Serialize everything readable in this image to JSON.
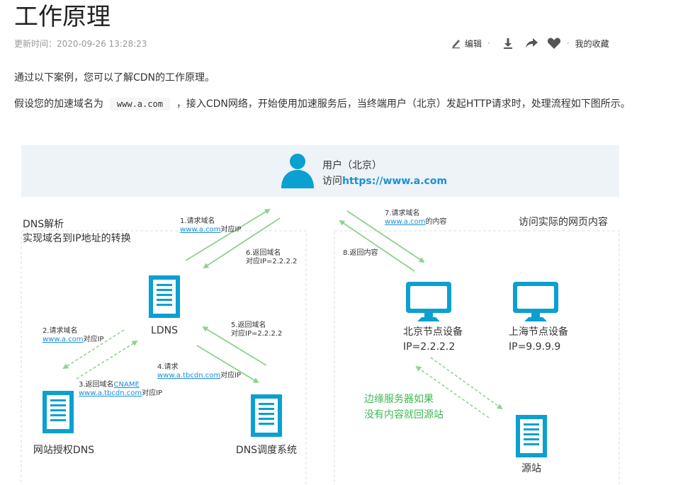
{
  "article": {
    "title": "工作原理",
    "updated": "更新时间：2020-09-26 13:28:23",
    "intro": "通过以下案例，您可以了解CDN的工作原理。",
    "para2_prefix": "假设您的加速域名为",
    "para2_code": "www.a.com",
    "para2_suffix": "，接入CDN网络，开始使用加速服务后，当终端用户（北京）发起HTTP请求时，处理流程如下图所示。"
  },
  "toolbar": {
    "edit": "编辑",
    "favorites": "我的收藏",
    "icons": [
      "edit-pen-icon",
      "download-icon",
      "share-icon",
      "heart-icon"
    ]
  },
  "diagram": {
    "user_line1": "用户（北京）",
    "user_line2_prefix": "访问",
    "user_line2_url": "https://www.a.com",
    "left_title_1": "DNS解析",
    "left_title_2": "实现域名到IP地址的转换",
    "right_title": "访问实际的网页内容",
    "step1_a": "1.请求域名",
    "step1_link": "www.a.com",
    "step1_b": "对应IP",
    "step6_a": "6.返回域名",
    "step6_b": "对应IP=2.2.2.2",
    "step2_a": "2.请求域名",
    "step2_link": "www.a.com",
    "step2_b": "对应IP",
    "step3_a": "3.返回域名",
    "step3_cname": "CNAME",
    "step3_link": "www.a.tbcdn.com",
    "step3_b": "对应IP",
    "step4_a": "4.请求",
    "step4_link": "www.a.tbcdn.com",
    "step4_b": "对应IP",
    "step5_a": "5.返回域名",
    "step5_b": "对应IP=2.2.2.2",
    "step7_a": "7.请求域名",
    "step7_link": "www.a.com",
    "step7_b": "的内容",
    "step8": "8.返回内容",
    "ldns": "LDNS",
    "auth_dns": "网站授权DNS",
    "dns_sched": "DNS调度系统",
    "bj_node": "北京节点设备",
    "bj_ip": "IP=2.2.2.2",
    "sh_node": "上海节点设备",
    "sh_ip": "IP=9.9.9.9",
    "origin": "源站",
    "edge_note_1": "边缘服务器如果",
    "edge_note_2": "没有内容就回源站"
  },
  "colors": {
    "accent": "#0aa0d0",
    "arrow": "#8ad48a",
    "green_text": "#3cb850",
    "link": "#1a8fd6",
    "banner": "#eef3f8"
  }
}
